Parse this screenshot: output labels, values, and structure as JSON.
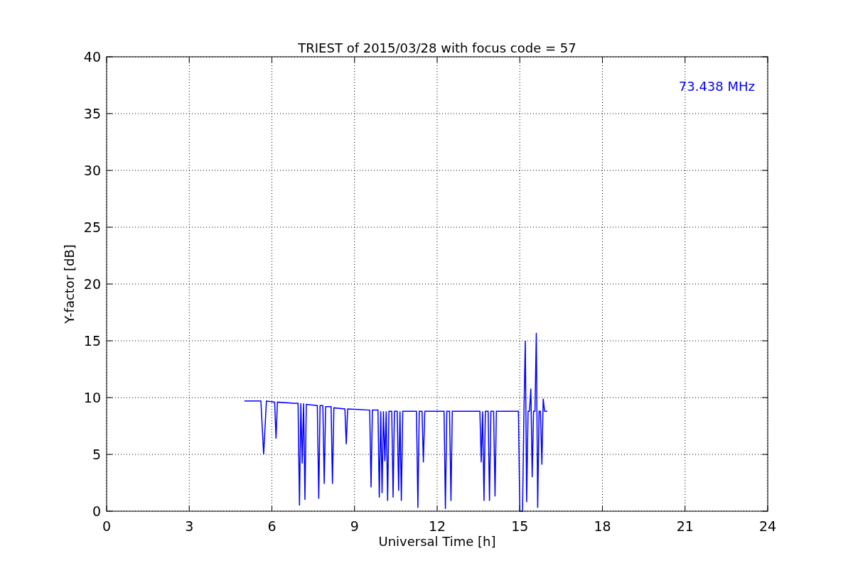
{
  "chart_data": {
    "type": "line",
    "title": "TRIEST of 2015/03/28 with focus code = 57",
    "xlabel": "Universal Time [h]",
    "ylabel": "Y-factor [dB]",
    "x": [
      5,
      5.6,
      5.7,
      5.8,
      6.1,
      6.15,
      6.2,
      6.8,
      6.95,
      7.0,
      7.05,
      7.1,
      7.15,
      7.2,
      7.25,
      7.65,
      7.7,
      7.75,
      7.85,
      7.9,
      7.95,
      8.15,
      8.2,
      8.25,
      8.65,
      8.7,
      8.75,
      9.55,
      9.6,
      9.65,
      9.85,
      9.9,
      9.95,
      10.0,
      10.05,
      10.1,
      10.15,
      10.2,
      10.25,
      10.35,
      10.4,
      10.45,
      10.55,
      10.6,
      10.65,
      10.7,
      10.75,
      11.25,
      11.3,
      11.35,
      11.45,
      11.5,
      11.55,
      12.25,
      12.3,
      12.35,
      12.45,
      12.5,
      12.55,
      13.55,
      13.6,
      13.65,
      13.7,
      13.75,
      13.85,
      13.9,
      13.95,
      14.05,
      14.1,
      14.15,
      14.95,
      15.0,
      15.1,
      15.15,
      15.2,
      15.25,
      15.3,
      15.35,
      15.4,
      15.45,
      15.5,
      15.55,
      15.6,
      15.65,
      15.7,
      15.75,
      15.8,
      15.85,
      15.9,
      16
    ],
    "series": [
      {
        "name": "73.438 MHz",
        "color": "#0000ff",
        "values": [
          9.7,
          9.7,
          5.0,
          9.7,
          9.6,
          6.4,
          9.6,
          9.5,
          9.5,
          0.5,
          9.5,
          4.2,
          9.5,
          1.0,
          9.4,
          9.3,
          1.1,
          9.3,
          9.3,
          2.4,
          9.2,
          9.2,
          2.4,
          9.1,
          9.0,
          5.9,
          9.0,
          8.9,
          2.1,
          8.9,
          8.9,
          1.2,
          8.8,
          1.6,
          8.8,
          4.4,
          8.8,
          0.9,
          8.8,
          8.8,
          1.2,
          8.8,
          8.8,
          1.8,
          8.8,
          0.9,
          8.8,
          8.8,
          0.3,
          8.8,
          8.8,
          4.3,
          8.8,
          8.8,
          0.2,
          8.8,
          8.8,
          0.9,
          8.8,
          8.8,
          4.3,
          8.8,
          0.9,
          8.8,
          8.8,
          0.9,
          8.8,
          8.8,
          1.3,
          8.8,
          8.8,
          0.0,
          0.0,
          8.8,
          15.0,
          0.8,
          8.8,
          8.8,
          10.8,
          3.0,
          8.8,
          8.8,
          15.7,
          0.3,
          8.8,
          8.8,
          4.1,
          9.9,
          8.8,
          8.8
        ]
      }
    ],
    "xlim": [
      0,
      24
    ],
    "ylim": [
      0,
      40
    ],
    "xticks": [
      0,
      3,
      6,
      9,
      12,
      15,
      18,
      21,
      24
    ],
    "yticks": [
      0,
      5,
      10,
      15,
      20,
      25,
      30,
      35,
      40
    ],
    "grid": true
  }
}
